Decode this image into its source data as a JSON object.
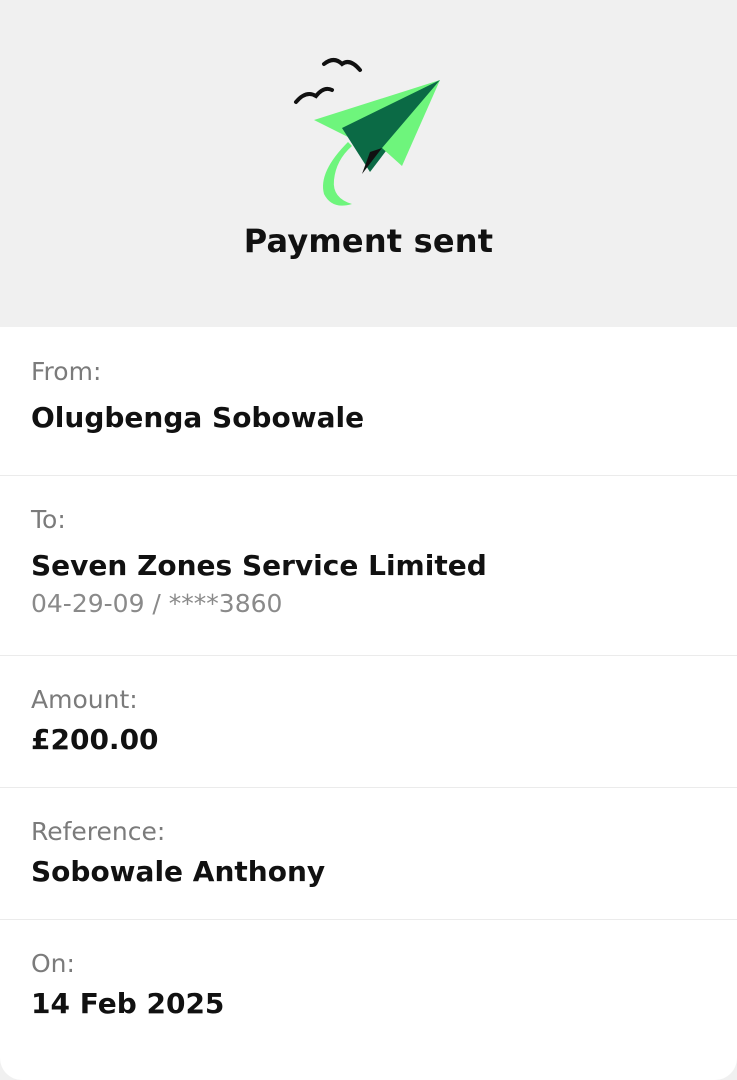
{
  "header": {
    "title": "Payment sent",
    "illustration": "paper-plane-with-birds-illustration",
    "colors": {
      "plane_light": "#6ef57c",
      "plane_dark": "#0b6a45",
      "birds": "#111111",
      "background": "#f0f0f0"
    }
  },
  "details": {
    "from": {
      "label": "From:",
      "value": "Olugbenga Sobowale"
    },
    "to": {
      "label": "To:",
      "value": "Seven Zones Service Limited",
      "account": "04-29-09 / ****3860"
    },
    "amount": {
      "label": "Amount:",
      "value": "£200.00"
    },
    "reference": {
      "label": "Reference:",
      "value": "Sobowale Anthony"
    },
    "date": {
      "label": "On:",
      "value": "14 Feb 2025"
    }
  }
}
